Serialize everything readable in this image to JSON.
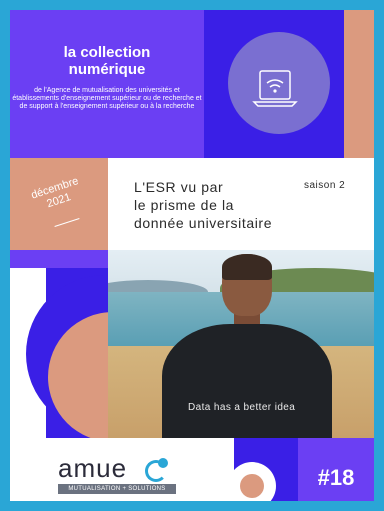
{
  "collection": {
    "title_line1": "la collection",
    "title_line2": "numérique",
    "description": "de l'Agence de mutualisation des universités et établissements d'enseignement supérieur ou de recherche et de support à l'enseignement supérieur ou à la recherche"
  },
  "date": {
    "month": "décembre",
    "year": "2021"
  },
  "title": {
    "line1": "L'ESR vu par",
    "line2": "le prisme de la",
    "line3": "donnée universitaire",
    "season": "saison 2"
  },
  "photo": {
    "shirt_text": "Data has a better idea"
  },
  "logo": {
    "name": "amue",
    "tagline": "MUTUALISATION + SOLUTIONS"
  },
  "issue": {
    "number": "#18"
  },
  "colors": {
    "frame": "#2aa6d6",
    "violet": "#6b3ff3",
    "blue": "#3a1fe6",
    "peach": "#db9a7f"
  },
  "icons": [
    "laptop-wifi-icon",
    "amue-logo-icon"
  ]
}
